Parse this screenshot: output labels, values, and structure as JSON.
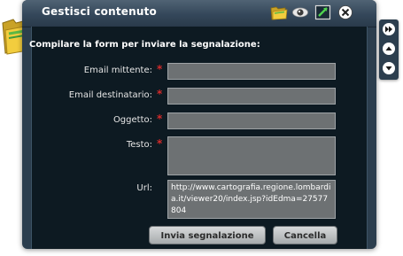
{
  "window": {
    "title": "Gestisci contenuto"
  },
  "toolbar": {
    "icons": [
      "folder-icon",
      "eye-icon",
      "resize-icon",
      "close-icon"
    ]
  },
  "form": {
    "heading": "Compilare la form per inviare la segnalazione:",
    "required_mark": "*",
    "fields": {
      "email_sender": {
        "label": "Email mittente:",
        "value": ""
      },
      "email_recipient": {
        "label": "Email destinatario:",
        "value": ""
      },
      "subject": {
        "label": "Oggetto:",
        "value": ""
      },
      "text": {
        "label": "Testo:",
        "value": ""
      },
      "url": {
        "label": "Url:",
        "value": "http://www.cartografia.regione.lombardia.it/viewer20/index.jsp?idEdma=27577804"
      }
    },
    "buttons": {
      "send": "Invia segnalazione",
      "cancel": "Cancella"
    }
  },
  "sidebar": {
    "icons": [
      "fast-forward-icon",
      "arrow-up-icon",
      "arrow-down-icon"
    ]
  },
  "colors": {
    "frame": "#2c3e4e",
    "panel": "#0d1a22",
    "field": "#6d7173",
    "required": "#d32a2a"
  }
}
